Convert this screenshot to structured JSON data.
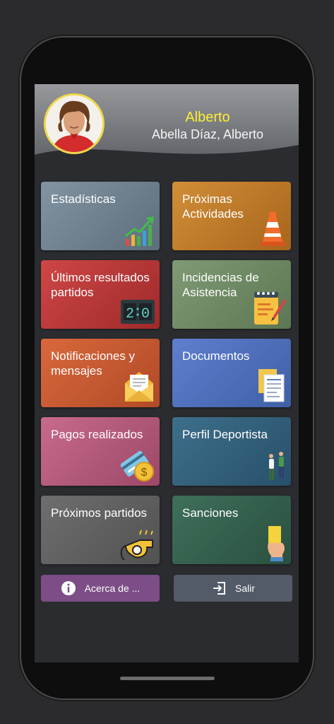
{
  "profile": {
    "first_name": "Alberto",
    "full_name": "Abella Díaz, Alberto"
  },
  "tiles": [
    {
      "label": "Estadísticas",
      "icon": "growth-chart-icon"
    },
    {
      "label": "Próximas Actividades",
      "icon": "traffic-cone-icon"
    },
    {
      "label": "Últimos resultados partidos",
      "icon": "scoreboard-icon"
    },
    {
      "label": "Incidencias de Asistencia",
      "icon": "notepad-icon"
    },
    {
      "label": "Notificaciones y mensajes",
      "icon": "envelope-icon"
    },
    {
      "label": "Documentos",
      "icon": "documents-icon"
    },
    {
      "label": "Pagos realizados",
      "icon": "payment-card-icon"
    },
    {
      "label": "Perfil Deportista",
      "icon": "athletes-icon"
    },
    {
      "label": "Próximos partidos",
      "icon": "whistle-icon"
    },
    {
      "label": "Sanciones",
      "icon": "yellow-card-icon"
    }
  ],
  "scoreboard": {
    "home": "2",
    "away": "0"
  },
  "buttons": {
    "about": "Acerca de ...",
    "logout": "Salir"
  },
  "colors": {
    "name": "#ffee33",
    "about_button": "#7c4d86",
    "logout_button": "#535a68"
  }
}
